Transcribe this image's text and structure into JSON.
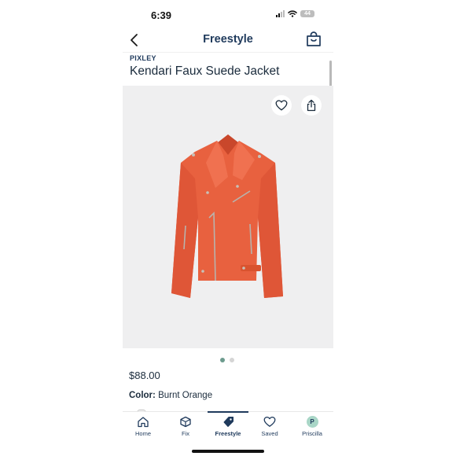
{
  "status_bar": {
    "time": "6:39",
    "battery": "44",
    "icons": [
      "cellular-signal-icon",
      "wifi-icon",
      "battery-icon"
    ]
  },
  "header": {
    "title": "Freestyle",
    "back_icon": "chevron-left-icon",
    "bag_icon": "shopping-bag-icon"
  },
  "product": {
    "brand": "PIXLEY",
    "name": "Kendari Faux Suede Jacket",
    "price": "$88.00",
    "color_label": "Color:",
    "color_value": "Burnt Orange",
    "image_icon": "jacket-image",
    "carousel": {
      "total": 2,
      "active": 1
    }
  },
  "image_actions": {
    "favorite_icon": "heart-icon",
    "share_icon": "share-icon"
  },
  "tabs": [
    {
      "label": "Home",
      "icon": "home-icon",
      "active": false
    },
    {
      "label": "Fix",
      "icon": "box-icon",
      "active": false
    },
    {
      "label": "Freestyle",
      "icon": "tag-icon",
      "active": true
    },
    {
      "label": "Saved",
      "icon": "heart-icon",
      "active": false
    },
    {
      "label": "Priscilla",
      "icon": "avatar",
      "active": false,
      "initial": "P"
    }
  ],
  "colors": {
    "brand_navy": "#1f3a5c",
    "jacket": "#e8613f",
    "image_bg": "#efeff0",
    "active_dot": "#6d9b8e",
    "avatar": "#a9d6c7"
  }
}
